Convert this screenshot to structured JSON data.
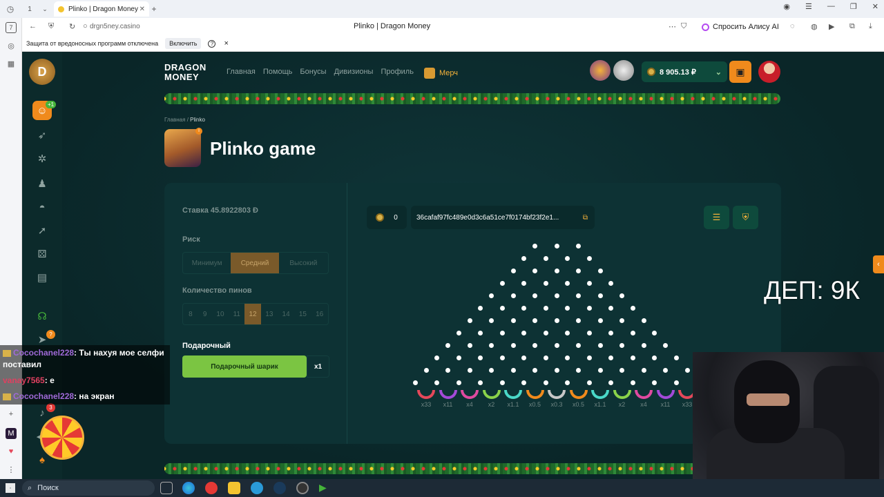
{
  "browser": {
    "tab_count": "1",
    "tab_title": "Plinko | Dragon Money",
    "url": "drgn5ney.casino",
    "page_title": "Plinko | Dragon Money",
    "alisa_label": "Спросить Алису AI",
    "infobar_text": "Защита от вредоносных программ отключена",
    "infobar_button": "Включить",
    "infobar_help": "?",
    "infobar_close": "×",
    "left_rail_badge": "7"
  },
  "site": {
    "brand_line1": "DRAGON",
    "brand_line2": "MONEY",
    "nav": [
      "Главная",
      "Помощь",
      "Бонусы",
      "Дивизионы",
      "Профиль"
    ],
    "merch": "Мерч",
    "balance": "8 905.13 ₽",
    "sidebar_badge": "+1",
    "sidebar_help_badge": "?",
    "sidebar_notif_badge": "3",
    "breadcrumb_home": "Главная",
    "breadcrumb_sep": "/",
    "breadcrumb_current": "Plinko",
    "game_title": "Plinko game"
  },
  "game": {
    "bet_label": "Ставка 45.8922803 Ð",
    "risk_label": "Риск",
    "risk_options": [
      "Минимум",
      "Средний",
      "Высокий"
    ],
    "risk_selected": "Средний",
    "pins_label": "Количество пинов",
    "pin_options": [
      "8",
      "9",
      "10",
      "11",
      "12",
      "13",
      "14",
      "15",
      "16"
    ],
    "pins_selected": "12",
    "gift_label": "Подарочный",
    "gift_button": "Подарочный шарик",
    "gift_multiplier": "x1",
    "balls_count": "0",
    "seed_hash": "36cafaf97fc489e0d3c6a51ce7f0174bf23f2e1...",
    "multipliers": [
      "x33",
      "x11",
      "x4",
      "x2",
      "x1.1",
      "x0.5",
      "x0.3",
      "x0.5",
      "x1.1",
      "x2",
      "x4",
      "x11",
      "x33"
    ],
    "bucket_colors": [
      "#e5485a",
      "#a34ad8",
      "#e04aa0",
      "#8ad34a",
      "#4ad8c8",
      "#f08a1c",
      "#c7c7c7",
      "#f08a1c",
      "#4ad8c8",
      "#8ad34a",
      "#e04aa0",
      "#a34ad8",
      "#e5485a"
    ]
  },
  "overlay": {
    "dep_text": "ДЕП: 9К",
    "chat": [
      {
        "user": "Cocochanel228",
        "text": ": Ты нахуя мое селфи поставил"
      },
      {
        "user": "vanay7565",
        "text": ": е"
      },
      {
        "user": "Cocochanel228",
        "text": ": на экран"
      }
    ]
  },
  "taskbar": {
    "search_placeholder": "Поиск"
  },
  "icons": [
    "history-icon",
    "back-icon",
    "forward-icon",
    "reload-icon",
    "bookmark-icon",
    "download-icon",
    "copy-icon",
    "menu-icon",
    "shield-icon",
    "coin-icon",
    "wallet-icon",
    "chevron-down-icon",
    "windows-icon",
    "search-icon"
  ]
}
